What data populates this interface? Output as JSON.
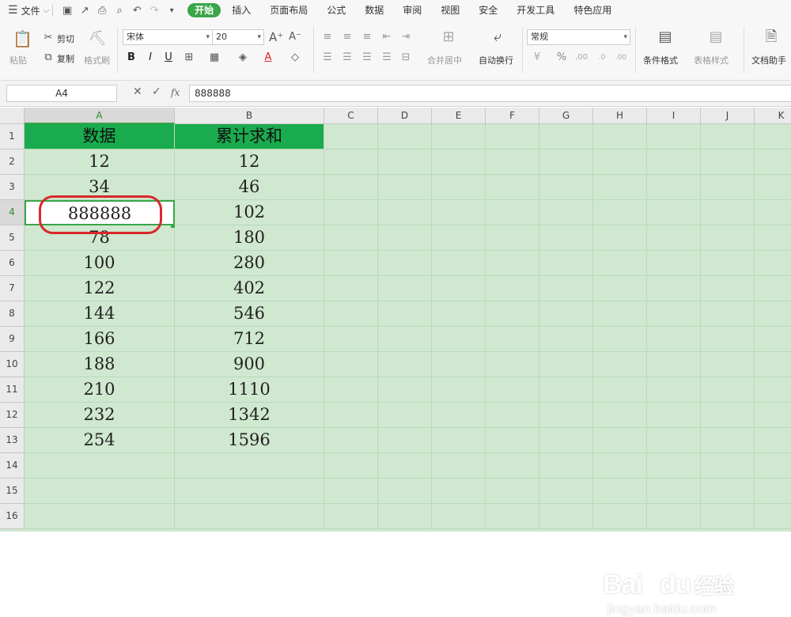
{
  "topbar": {
    "menu_label": "文件",
    "tabs": [
      "开始",
      "插入",
      "页面布局",
      "公式",
      "数据",
      "审阅",
      "视图",
      "安全",
      "开发工具",
      "特色应用"
    ],
    "active_tab": "开始"
  },
  "ribbon": {
    "paste": "粘贴",
    "cut": "剪切",
    "copy": "复制",
    "format_painter": "格式刷",
    "font_name": "宋体",
    "font_size": "20",
    "bold": "B",
    "italic": "I",
    "underline": "U",
    "merge_center": "合并居中",
    "wrap_text": "自动换行",
    "number_format": "常规",
    "percent": "%",
    "conditional_format": "条件格式",
    "table_style": "表格样式",
    "doc_assistant": "文档助手"
  },
  "formula_bar": {
    "name_box": "A4",
    "fx": "fx",
    "value": "888888"
  },
  "columns": [
    "A",
    "B",
    "C",
    "D",
    "E",
    "F",
    "G",
    "H",
    "I",
    "J",
    "K"
  ],
  "rows": [
    "1",
    "2",
    "3",
    "4",
    "5",
    "6",
    "7",
    "8",
    "9",
    "10",
    "11",
    "12",
    "13",
    "14",
    "15",
    "16"
  ],
  "sheet": {
    "header": [
      "数据",
      "累计求和"
    ],
    "data": [
      [
        "12",
        "12"
      ],
      [
        "34",
        "46"
      ],
      [
        "888888",
        "102"
      ],
      [
        "78",
        "180"
      ],
      [
        "100",
        "280"
      ],
      [
        "122",
        "402"
      ],
      [
        "144",
        "546"
      ],
      [
        "166",
        "712"
      ],
      [
        "188",
        "900"
      ],
      [
        "210",
        "1110"
      ],
      [
        "232",
        "1342"
      ],
      [
        "254",
        "1596"
      ]
    ],
    "selected_cell": "A4"
  },
  "watermark": {
    "brand": "Bai",
    "brand2": "du",
    "suffix": "经验",
    "url": "jingyan.baidu.com"
  },
  "colors": {
    "accent": "#3aa549",
    "header_fill": "#1aab4f",
    "grid_bg": "#cfe8cf",
    "highlight": "#d8282b"
  }
}
